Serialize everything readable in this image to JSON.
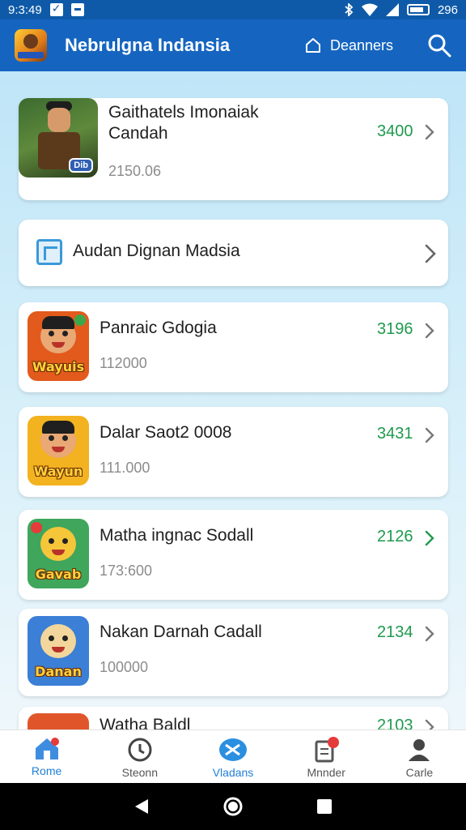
{
  "status_bar": {
    "time": "9:3:49",
    "battery": "296"
  },
  "app_bar": {
    "title": "Nebrulgna Indansia",
    "link_label": "Deanners"
  },
  "featured": {
    "title": "Gaithatels Imonaiak Candah",
    "subtitle": "2150.06",
    "value": "3400",
    "badge": "Dib"
  },
  "banner": {
    "label": "Audan Dignan Madsia"
  },
  "items": [
    {
      "title": "Panraic Gdogia",
      "subtitle": "112000",
      "value": "3196",
      "thumb_label": "Wayuis",
      "thumb_bg": "#e25a1c"
    },
    {
      "title": "Dalar Saot2 0008",
      "subtitle": "111.000",
      "value": "3431",
      "thumb_label": "Wayun",
      "thumb_bg": "#f3b21f"
    },
    {
      "title": "Matha ingnac Sodall",
      "subtitle": "173:600",
      "value": "2126",
      "thumb_label": "Gavab",
      "thumb_bg": "#3fa65c"
    },
    {
      "title": "Nakan Darnah Cadall",
      "subtitle": "100000",
      "value": "2134",
      "thumb_label": "Danan",
      "thumb_bg": "#3b7fd6"
    },
    {
      "title": "Watha Baldl",
      "value": "2103"
    }
  ],
  "bottom_nav": [
    {
      "label": "Rome"
    },
    {
      "label": "Steonn"
    },
    {
      "label": "Vladans"
    },
    {
      "label": "Mnnder"
    },
    {
      "label": "Carle"
    }
  ],
  "colors": {
    "accent": "#1565c0",
    "value_green": "#1f9a4e",
    "active_nav": "#1f7fd6"
  }
}
